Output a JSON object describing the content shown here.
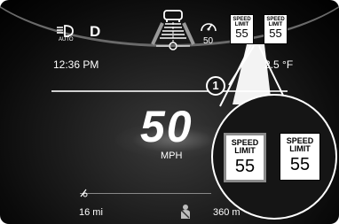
{
  "status_bar": {
    "gear": "D",
    "headlight_mode": "AUTO",
    "set_speed": "50"
  },
  "speed_signs_small": [
    {
      "title_line1": "SPEED",
      "title_line2": "LIMIT",
      "value": "55"
    },
    {
      "title_line1": "SPEED",
      "title_line2": "LIMIT",
      "value": "55"
    }
  ],
  "info_row": {
    "time": "12:36 PM",
    "temperature": "2.5 °F"
  },
  "speed": {
    "value": "50",
    "unit": "MPH"
  },
  "bottom_row": {
    "trip": "16 mi",
    "range": "360 m"
  },
  "callout": {
    "number": "1"
  },
  "speed_signs_large": [
    {
      "title_line1": "SPEED",
      "title_line2": "LIMIT",
      "value": "55"
    },
    {
      "title_line1": "SPEED",
      "title_line2": "LIMIT",
      "value": "55"
    }
  ],
  "colors": {
    "background": "#000000",
    "text": "#ffffff",
    "sign_background": "#ffffff",
    "lane_accent": "#9a9a9a"
  }
}
